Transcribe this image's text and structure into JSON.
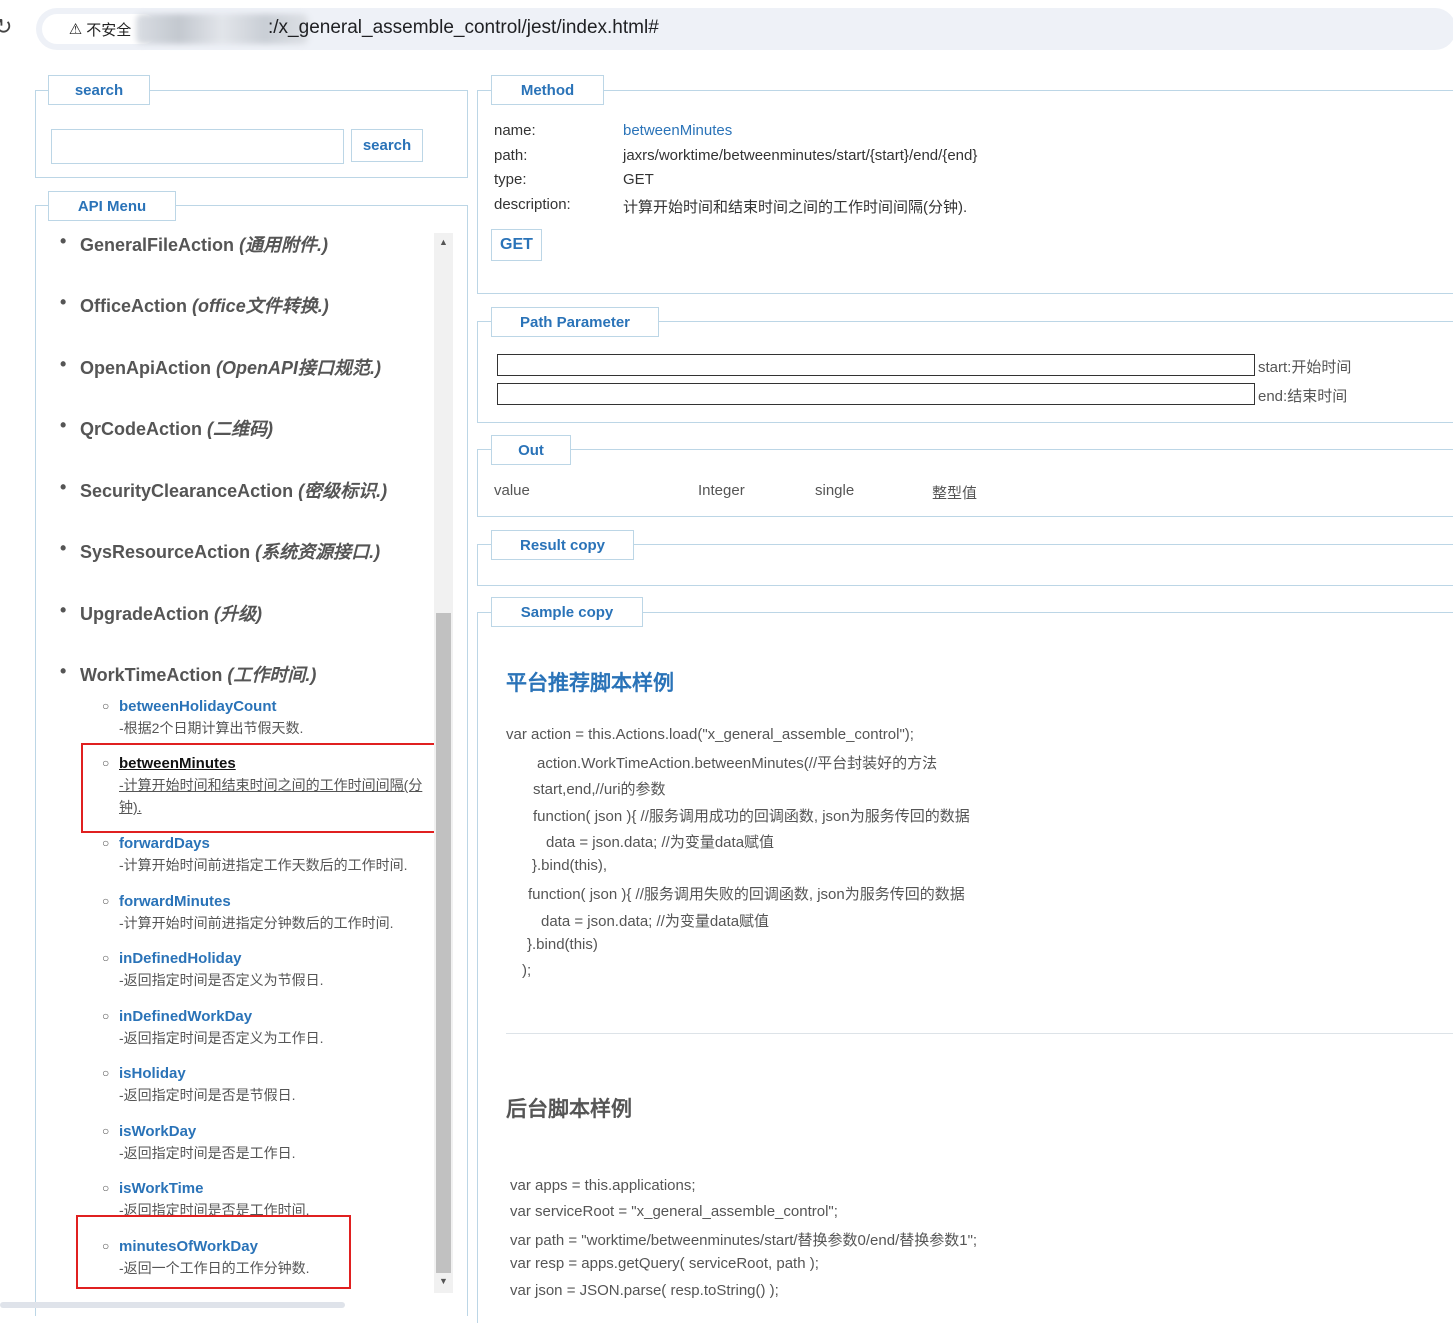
{
  "browser": {
    "secure_label": "不安全",
    "url_suffix": ":/x_general_assemble_control/jest/index.html#"
  },
  "search": {
    "legend": "search",
    "input_value": "",
    "button": "search"
  },
  "api_menu": {
    "legend": "API Menu",
    "top_items": [
      {
        "name": "GeneralFileAction",
        "desc": "(通用附件.)"
      },
      {
        "name": "OfficeAction",
        "desc": "(office文件转换.)"
      },
      {
        "name": "OpenApiAction",
        "desc": "(OpenAPI接口规范.)"
      },
      {
        "name": "QrCodeAction",
        "desc": "(二维码)"
      },
      {
        "name": "SecurityClearanceAction",
        "desc": "(密级标识.)"
      },
      {
        "name": "SysResourceAction",
        "desc": "(系统资源接口.)"
      },
      {
        "name": "UpgradeAction",
        "desc": "(升级)"
      },
      {
        "name": "WorkTimeAction",
        "desc": "(工作时间.)"
      }
    ],
    "sub_items": [
      {
        "name": "betweenHolidayCount",
        "desc": "-根据2个日期计算出节假天数."
      },
      {
        "name": "betweenMinutes",
        "desc": "-计算开始时间和结束时间之间的工作时间间隔(分钟)."
      },
      {
        "name": "forwardDays",
        "desc": "-计算开始时间前进指定工作天数后的工作时间."
      },
      {
        "name": "forwardMinutes",
        "desc": "-计算开始时间前进指定分钟数后的工作时间."
      },
      {
        "name": "inDefinedHoliday",
        "desc": "-返回指定时间是否定义为节假日."
      },
      {
        "name": "inDefinedWorkDay",
        "desc": "-返回指定时间是否定义为工作日."
      },
      {
        "name": "isHoliday",
        "desc": "-返回指定时间是否是节假日."
      },
      {
        "name": "isWorkDay",
        "desc": "-返回指定时间是否是工作日."
      },
      {
        "name": "isWorkTime",
        "desc": "-返回指定时间是否是工作时间."
      },
      {
        "name": "minutesOfWorkDay",
        "desc": "-返回一个工作日的工作分钟数."
      }
    ]
  },
  "method": {
    "legend": "Method",
    "name_label": "name:",
    "name": "betweenMinutes",
    "path_label": "path:",
    "path": "jaxrs/worktime/betweenminutes/start/{start}/end/{end}",
    "type_label": "type:",
    "type": "GET",
    "description_label": "description:",
    "description": "计算开始时间和结束时间之间的工作时间间隔(分钟).",
    "button": "GET"
  },
  "path_parameter": {
    "legend": "Path Parameter",
    "params": [
      {
        "value": "",
        "label": "start:开始时间"
      },
      {
        "value": "",
        "label": "end:结束时间"
      }
    ]
  },
  "out": {
    "legend": "Out",
    "row": [
      "value",
      "Integer",
      "single",
      "整型值"
    ]
  },
  "result": {
    "legend": "Result copy"
  },
  "sample": {
    "legend": "Sample copy",
    "frontend_title": "平台推荐脚本样例",
    "frontend_code": [
      "var action = this.Actions.load(\"x_general_assemble_control\");",
      "action.WorkTimeAction.betweenMinutes(//平台封装好的方法",
      "start,end,//uri的参数",
      "function( json ){ //服务调用成功的回调函数, json为服务传回的数据",
      "data = json.data; //为变量data赋值",
      "}.bind(this),",
      "function( json ){ //服务调用失败的回调函数, json为服务传回的数据",
      "data = json.data; //为变量data赋值",
      "}.bind(this)",
      ");"
    ],
    "backend_title": "后台脚本样例",
    "backend_code": [
      "var apps = this.applications;",
      "var serviceRoot = \"x_general_assemble_control\";",
      "var path = \"worktime/betweenminutes/start/替换参数0/end/替换参数1\";",
      "var resp = apps.getQuery( serviceRoot, path );",
      "var json = JSON.parse( resp.toString() );"
    ]
  }
}
